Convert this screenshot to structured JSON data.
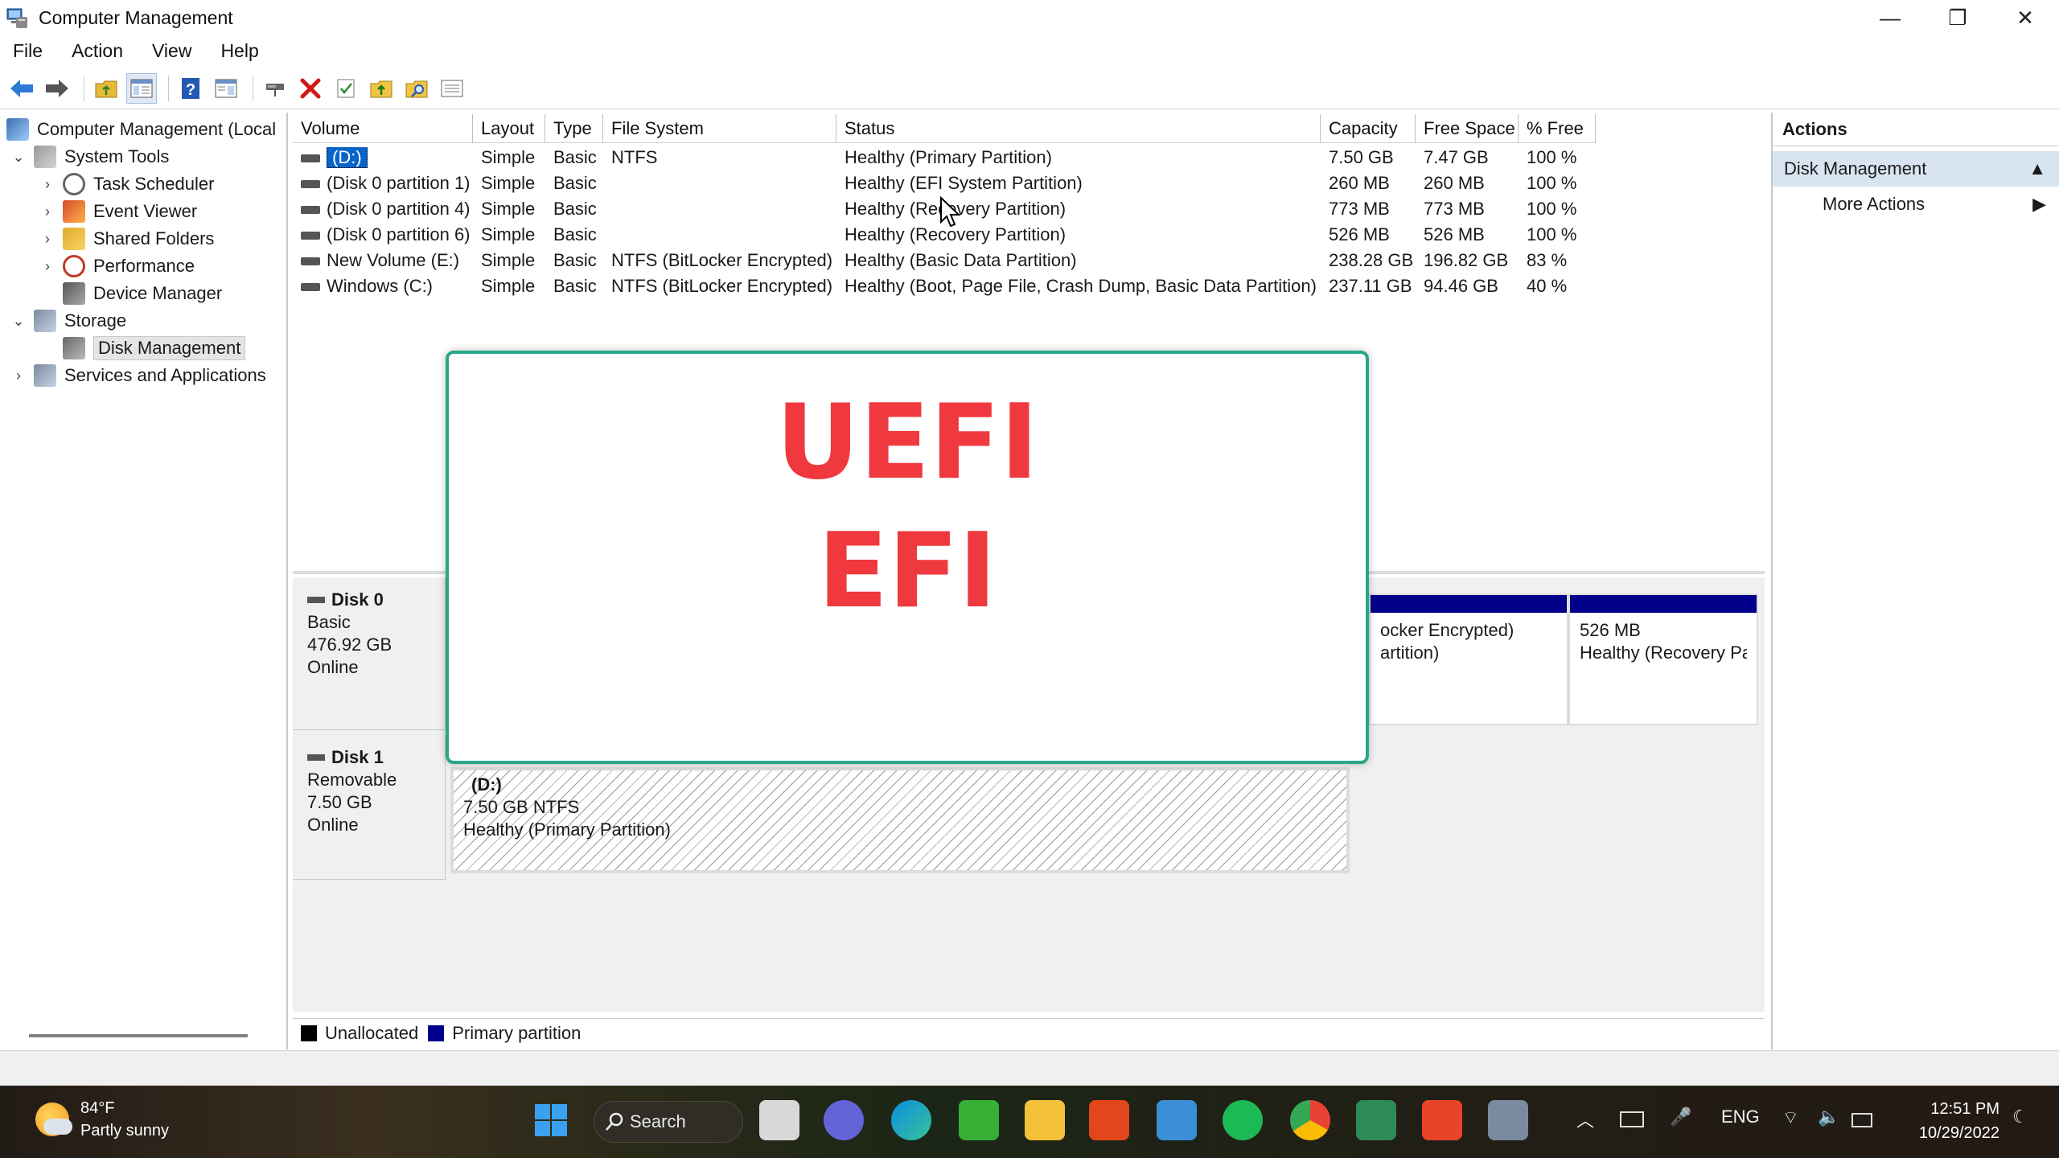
{
  "window": {
    "title": "Computer Management",
    "minimize_glyph": "—",
    "restore_glyph": "❐",
    "close_glyph": "✕"
  },
  "menu": [
    "File",
    "Action",
    "View",
    "Help"
  ],
  "toolbar_icons": [
    "back-arrow-icon",
    "forward-arrow-icon",
    "up-folder-icon",
    "show-hide-tree-icon",
    "help-icon",
    "properties-icon",
    "connect-icon",
    "delete-icon",
    "check-icon",
    "open-folder-icon",
    "search-folder-icon",
    "list-view-icon"
  ],
  "tree": {
    "root": "Computer Management (Local",
    "system_tools": "System Tools",
    "task_scheduler": "Task Scheduler",
    "event_viewer": "Event Viewer",
    "shared_folders": "Shared Folders",
    "performance": "Performance",
    "device_manager": "Device Manager",
    "storage": "Storage",
    "disk_management": "Disk Management",
    "services_apps": "Services and Applications"
  },
  "volume_list": {
    "columns": [
      "Volume",
      "Layout",
      "Type",
      "File System",
      "Status",
      "Capacity",
      "Free Space",
      "% Free"
    ],
    "rows": [
      {
        "volume": "(D:)",
        "layout": "Simple",
        "type": "Basic",
        "fs": "NTFS",
        "status": "Healthy (Primary Partition)",
        "capacity": "7.50 GB",
        "free": "7.47 GB",
        "pct": "100 %"
      },
      {
        "volume": "(Disk 0 partition 1)",
        "layout": "Simple",
        "type": "Basic",
        "fs": "",
        "status": "Healthy (EFI System Partition)",
        "capacity": "260 MB",
        "free": "260 MB",
        "pct": "100 %"
      },
      {
        "volume": "(Disk 0 partition 4)",
        "layout": "Simple",
        "type": "Basic",
        "fs": "",
        "status": "Healthy (Recovery Partition)",
        "capacity": "773 MB",
        "free": "773 MB",
        "pct": "100 %"
      },
      {
        "volume": "(Disk 0 partition 6)",
        "layout": "Simple",
        "type": "Basic",
        "fs": "",
        "status": "Healthy (Recovery Partition)",
        "capacity": "526 MB",
        "free": "526 MB",
        "pct": "100 %"
      },
      {
        "volume": "New Volume (E:)",
        "layout": "Simple",
        "type": "Basic",
        "fs": "NTFS (BitLocker Encrypted)",
        "status": "Healthy (Basic Data Partition)",
        "capacity": "238.28 GB",
        "free": "196.82 GB",
        "pct": "83 %"
      },
      {
        "volume": "Windows (C:)",
        "layout": "Simple",
        "type": "Basic",
        "fs": "NTFS (BitLocker Encrypted)",
        "status": "Healthy (Boot, Page File, Crash Dump, Basic Data Partition)",
        "capacity": "237.11 GB",
        "free": "94.46 GB",
        "pct": "40 %"
      }
    ]
  },
  "disks": {
    "disk0": {
      "name": "Disk 0",
      "kind": "Basic",
      "size": "476.92 GB",
      "state": "Online",
      "partial_a_line1": "ocker Encrypted)",
      "partial_a_line2": "artition)",
      "partial_b_line1": "526 MB",
      "partial_b_line2": "Healthy (Recovery Pa"
    },
    "disk1": {
      "name": "Disk 1",
      "kind": "Removable",
      "size": "7.50 GB",
      "state": "Online",
      "part_name": "(D:)",
      "part_size": "7.50 GB NTFS",
      "part_status": "Healthy (Primary Partition)"
    }
  },
  "legend": {
    "unallocated": "Unallocated",
    "primary": "Primary partition"
  },
  "actions": {
    "title": "Actions",
    "section": "Disk Management",
    "more": "More Actions"
  },
  "overlay": {
    "line1": "UEFI",
    "line2": "EFI"
  },
  "colors": {
    "accent_overlay_border": "#28a78a",
    "overlay_text": "#f0393e",
    "primary_partition": "#00008b"
  },
  "taskbar": {
    "weather_temp": "84°F",
    "weather_desc": "Partly sunny",
    "search_label": "Search",
    "lang": "ENG",
    "time": "12:51 PM",
    "date": "10/29/2022"
  }
}
